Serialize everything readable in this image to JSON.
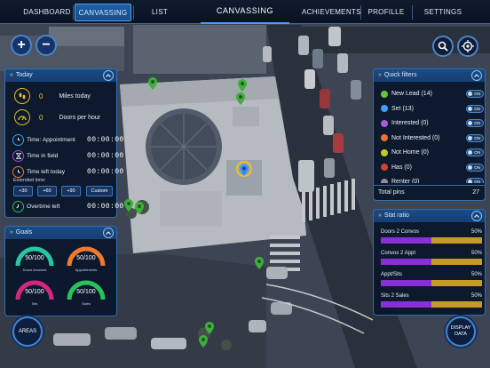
{
  "nav": {
    "tabs": [
      "DASHBOARD",
      "CANVASSING",
      "LIST",
      "ACHIEVEMENTS",
      "PROFILLE",
      "SETTINGS"
    ],
    "title": "CANVASSING",
    "active": "CANVASSING"
  },
  "map_controls": {
    "zoom_in": "+",
    "zoom_out": "−",
    "search_icon": "search-icon",
    "locate_icon": "crosshair-icon"
  },
  "today": {
    "title": "Today",
    "miles_value": "0",
    "miles_label": "Miles today",
    "doors_value": "0",
    "doors_label": "Doors per hour",
    "rows": [
      {
        "label": "Time: Appointment",
        "value": "00:00:00"
      },
      {
        "label": "Time in field",
        "value": "00:00:00"
      },
      {
        "label": "Time left today",
        "value": "00:00:00"
      }
    ],
    "extended_label": "Extended time:",
    "buttons": [
      "+30",
      "+60",
      "+90",
      "Custom"
    ],
    "overtime_label": "Overtime left",
    "overtime_value": "00:00:00"
  },
  "goals": {
    "title": "Goals",
    "items": [
      {
        "value": "50/100",
        "label": "Doors knocked",
        "color": "#29c7a0"
      },
      {
        "value": "50/100",
        "label": "Appointments",
        "color": "#f07a2a"
      },
      {
        "value": "50/100",
        "label": "Sits",
        "color": "#d6287a"
      },
      {
        "value": "50/100",
        "label": "Sales",
        "color": "#27c45e"
      }
    ]
  },
  "quick_filters": {
    "title": "Quick filters",
    "toggle_text": "ON",
    "items": [
      {
        "label": "New Lead (14)",
        "color": "#6cc43a"
      },
      {
        "label": "Set (13)",
        "color": "#3ea0ff"
      },
      {
        "label": "Interested (0)",
        "color": "#b05ad8"
      },
      {
        "label": "Not Interested (0)",
        "color": "#f07030"
      },
      {
        "label": "Not Home (0)",
        "color": "#c8c820"
      },
      {
        "label": "Has (0)",
        "color": "#d04030"
      },
      {
        "label": "Renter (0)",
        "color": "#8e8e8e"
      }
    ],
    "total_label": "Total pins",
    "total_value": "27"
  },
  "stat_ratio": {
    "title": "Stat ratio",
    "items": [
      {
        "label": "Doors 2 Convos",
        "pct": "50%",
        "fill": 0.5
      },
      {
        "label": "Convos 2 Appt",
        "pct": "50%",
        "fill": 0.5
      },
      {
        "label": "Appt/Sits",
        "pct": "50%",
        "fill": 0.5
      },
      {
        "label": "Sits 2 Sales",
        "pct": "50%",
        "fill": 0.5
      }
    ],
    "bar_colors": {
      "filled": "#8a2fd6",
      "rest": "#c79a2a"
    }
  },
  "bottom": {
    "areas_label": "AREAS",
    "display_label_1": "DISPLAY",
    "display_label_2": "DATA"
  }
}
